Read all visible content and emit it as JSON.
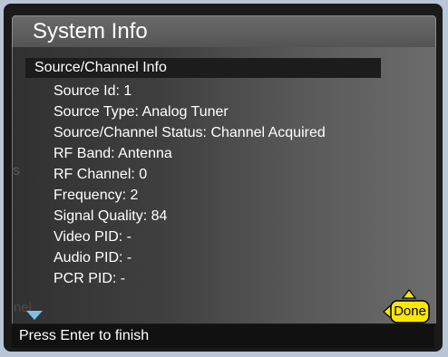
{
  "window": {
    "title": "System Info"
  },
  "ghost_text": {
    "left_s": "s",
    "left_nel": "nel"
  },
  "section": {
    "header": "Source/Channel Info",
    "items": [
      "Source Id: 1",
      "Source Type: Analog Tuner",
      "Source/Channel Status: Channel Acquired",
      "RF Band: Antenna",
      "RF Channel: 0",
      "Frequency: 2",
      "Signal Quality: 84",
      "Video PID: -",
      "Audio PID: -",
      "PCR PID: -"
    ]
  },
  "controls": {
    "done_label": "Done"
  },
  "status": {
    "hint": "Press Enter to finish"
  },
  "colors": {
    "scroll_arrow": "#7fbfe6",
    "done_fill": "#ffe600",
    "done_outline": "#000000"
  }
}
